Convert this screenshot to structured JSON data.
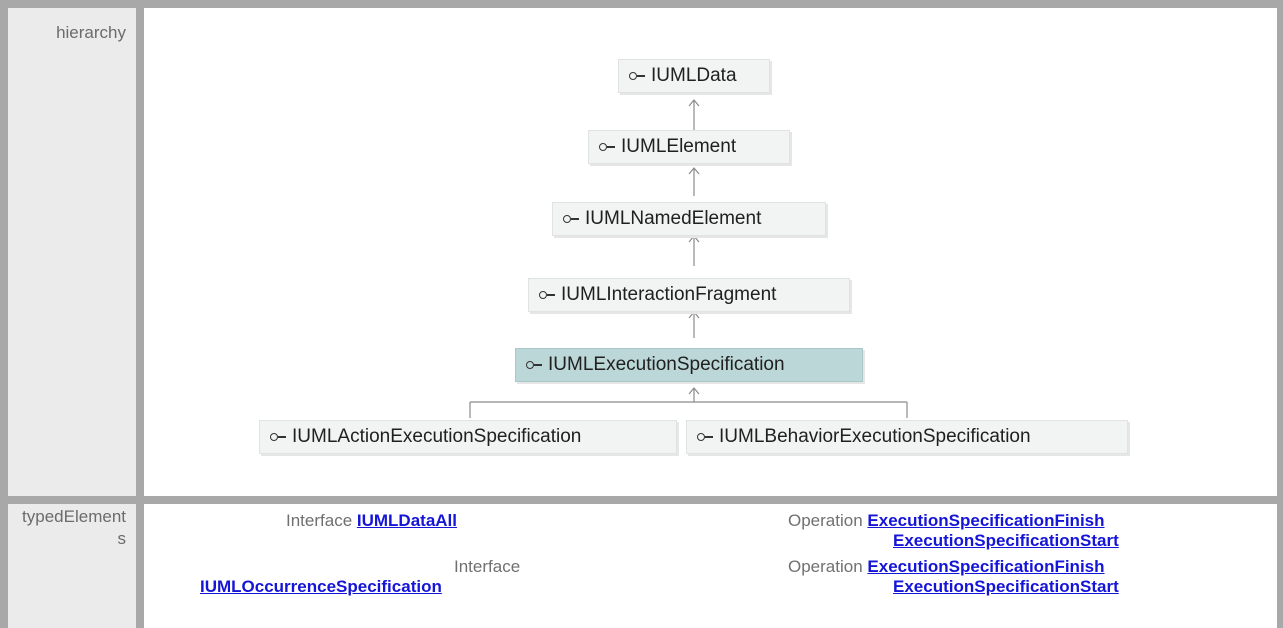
{
  "hierarchy_label": "hierarchy",
  "typed_label": "typedElements",
  "nodes": [
    {
      "name": "IUMLData",
      "icon": "interface-icon"
    },
    {
      "name": "IUMLElement",
      "icon": "interface-icon"
    },
    {
      "name": "IUMLNamedElement",
      "icon": "interface-icon"
    },
    {
      "name": "IUMLInteractionFragment",
      "icon": "interface-icon"
    },
    {
      "name": "IUMLExecutionSpecification",
      "icon": "interface-icon",
      "current": true
    },
    {
      "name": "IUMLActionExecutionSpecification",
      "icon": "interface-icon"
    },
    {
      "name": "IUMLBehaviorExecutionSpecification",
      "icon": "interface-icon"
    }
  ],
  "typed_elements": [
    {
      "kind": "Interface",
      "name": "IUMLDataAll",
      "operation_kind": "Operation",
      "operations": [
        "ExecutionSpecificationFinish",
        "ExecutionSpecificationStart"
      ]
    },
    {
      "kind": "Interface",
      "name": "IUMLOccurrenceSpecification",
      "operation_kind": "Operation",
      "operations": [
        "ExecutionSpecificationFinish",
        "ExecutionSpecificationStart"
      ]
    }
  ],
  "colors": {
    "border": "#a8a8a8",
    "label_bg": "#ebebeb",
    "node_bg": "#f2f4f4",
    "current_node_bg": "#bcd7d8",
    "link": "#1515d8"
  }
}
